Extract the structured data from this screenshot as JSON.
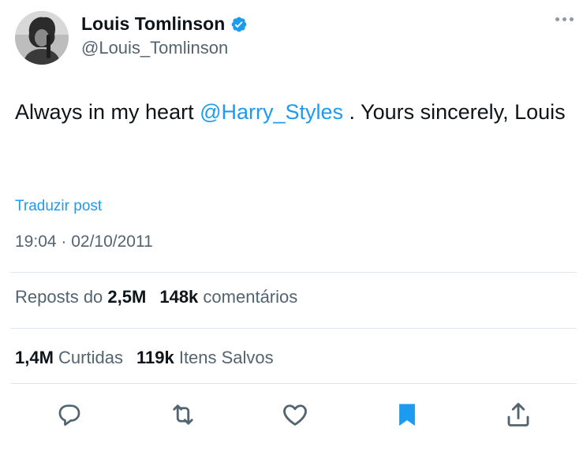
{
  "author": {
    "display_name": "Louis Tomlinson",
    "handle": "@Louis_Tomlinson",
    "verified": true
  },
  "tweet": {
    "text_before": "Always in my heart ",
    "mention": "@Harry_Styles",
    "text_after": " . Yours sincerely, Louis"
  },
  "translate_label": "Traduzir post",
  "timestamp": "19:04 · 02/10/2011",
  "stats": {
    "reposts_prefix": "Reposts do",
    "reposts_count": "2,5M",
    "comments_count": "148k",
    "comments_label": "comentários",
    "likes_count": "1,4M",
    "likes_label": "Curtidas",
    "saves_count": "119k",
    "saves_label": "Itens Salvos"
  },
  "colors": {
    "accent": "#1d9bf0",
    "text_primary": "#0f1419",
    "text_secondary": "#536471",
    "divider": "#e1e8ed",
    "action_icon": "#536471"
  },
  "icons": {
    "more": "more-horizontal-icon",
    "verified": "verified-badge-icon",
    "reply": "reply-icon",
    "repost": "repost-icon",
    "like": "heart-icon",
    "bookmark": "bookmark-filled-icon",
    "share": "share-icon"
  }
}
